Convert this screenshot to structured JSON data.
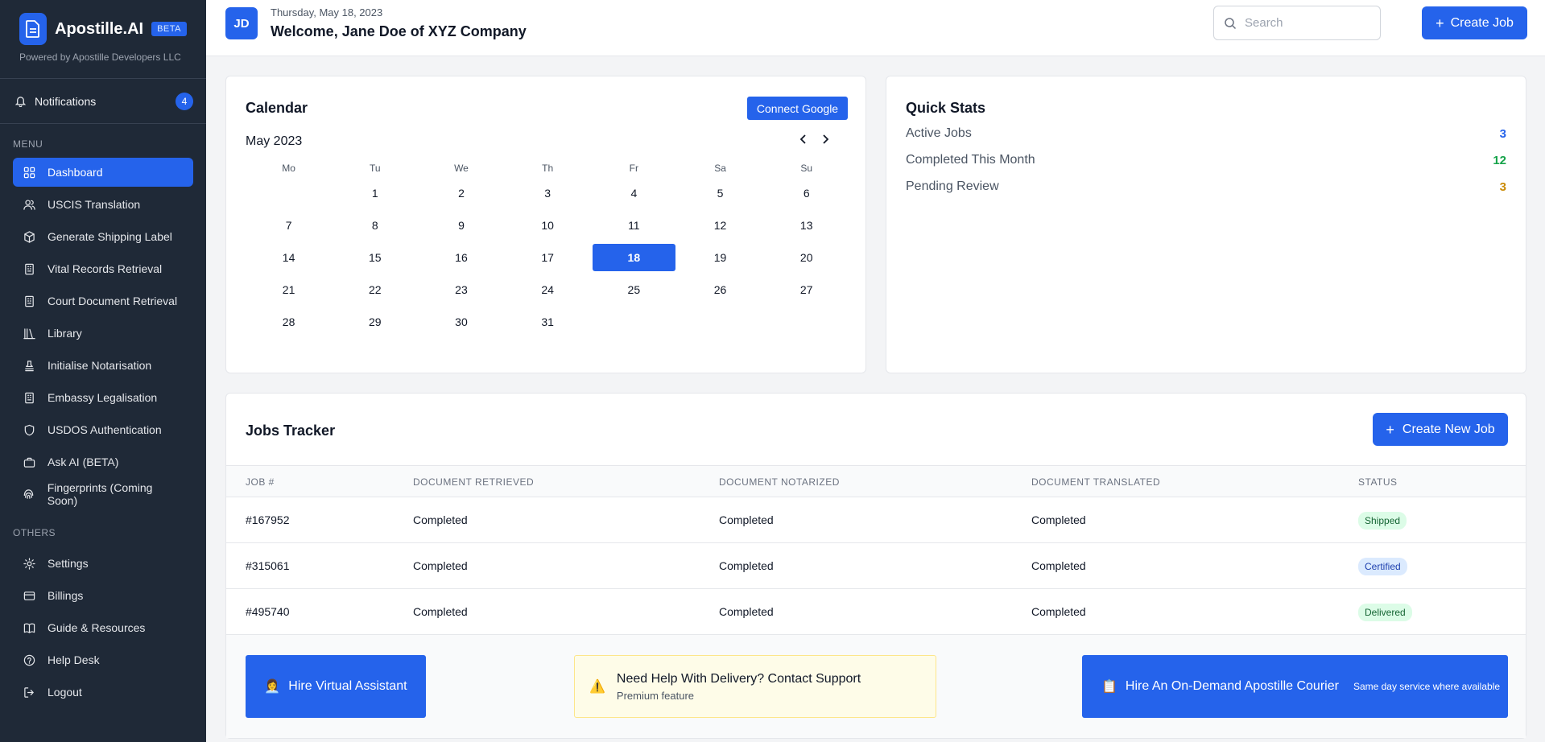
{
  "brand": {
    "name": "Apostille.AI",
    "badge": "BETA",
    "subtitle": "Powered by Apostille Developers LLC"
  },
  "notifications": {
    "label": "Notifications",
    "count": "4"
  },
  "menu": {
    "title": "MENU",
    "items": [
      {
        "label": "Dashboard",
        "icon": "grid-icon",
        "active": true
      },
      {
        "label": "USCIS Translation",
        "icon": "users-icon"
      },
      {
        "label": "Generate Shipping Label",
        "icon": "package-icon"
      },
      {
        "label": "Vital Records Retrieval",
        "icon": "building-icon"
      },
      {
        "label": "Court Document Retrieval",
        "icon": "building-icon"
      },
      {
        "label": "Library",
        "icon": "library-icon"
      },
      {
        "label": "Initialise Notarisation",
        "icon": "stamp-icon"
      },
      {
        "label": "Embassy Legalisation",
        "icon": "building-icon"
      },
      {
        "label": "USDOS Authentication",
        "icon": "shield-icon"
      },
      {
        "label": "Ask AI (BETA)",
        "icon": "briefcase-icon"
      },
      {
        "label": "Fingerprints (Coming Soon)",
        "icon": "fingerprint-icon"
      }
    ]
  },
  "others": {
    "title": "OTHERS",
    "items": [
      {
        "label": "Settings",
        "icon": "gear-icon"
      },
      {
        "label": "Billings",
        "icon": "credit-card-icon"
      },
      {
        "label": "Guide & Resources",
        "icon": "book-icon"
      },
      {
        "label": "Help Desk",
        "icon": "help-circle-icon"
      },
      {
        "label": "Logout",
        "icon": "logout-icon"
      }
    ]
  },
  "header": {
    "avatar": "JD",
    "date": "Thursday, May 18, 2023",
    "welcome": "Welcome, Jane Doe of XYZ Company",
    "search_placeholder": "Search",
    "create_job": "Create Job"
  },
  "calendar": {
    "title": "Calendar",
    "connect": "Connect Google",
    "month": "May 2023",
    "weekdays": [
      "Mo",
      "Tu",
      "We",
      "Th",
      "Fr",
      "Sa",
      "Su"
    ],
    "weeks": [
      [
        "",
        "1",
        "2",
        "3",
        "4",
        "5",
        "6"
      ],
      [
        "7",
        "8",
        "9",
        "10",
        "11",
        "12",
        "13"
      ],
      [
        "14",
        "15",
        "16",
        "17",
        "18",
        "19",
        "20"
      ],
      [
        "21",
        "22",
        "23",
        "24",
        "25",
        "26",
        "27"
      ],
      [
        "28",
        "29",
        "30",
        "31",
        "",
        "",
        ""
      ]
    ],
    "today": "18"
  },
  "quick_stats": {
    "title": "Quick Stats",
    "items": [
      {
        "label": "Active Jobs",
        "value": "3",
        "color": "#2563eb"
      },
      {
        "label": "Completed This Month",
        "value": "12",
        "color": "#16a34a"
      },
      {
        "label": "Pending Review",
        "value": "3",
        "color": "#ca8a04"
      }
    ]
  },
  "jobs": {
    "title": "Jobs Tracker",
    "create_new": "Create New Job",
    "columns": [
      "JOB #",
      "DOCUMENT RETRIEVED",
      "DOCUMENT NOTARIZED",
      "DOCUMENT TRANSLATED",
      "STATUS"
    ],
    "rows": [
      {
        "job": "#167952",
        "retrieved": "Completed",
        "notarized": "Completed",
        "translated": "Completed",
        "status": "Shipped",
        "status_color": "green"
      },
      {
        "job": "#315061",
        "retrieved": "Completed",
        "notarized": "Completed",
        "translated": "Completed",
        "status": "Certified",
        "status_color": "blue"
      },
      {
        "job": "#495740",
        "retrieved": "Completed",
        "notarized": "Completed",
        "translated": "Completed",
        "status": "Delivered",
        "status_color": "green"
      }
    ]
  },
  "actions": {
    "hire_va": "Hire Virtual Assistant",
    "hire_va_icon": "👩‍💼",
    "support_main": "Need Help With Delivery? Contact Support",
    "support_sub": "Premium feature",
    "support_icon": "⚠️",
    "courier_main": "Hire An On-Demand Apostille Courier",
    "courier_sub": "Same day service where available",
    "courier_icon": "📋"
  }
}
